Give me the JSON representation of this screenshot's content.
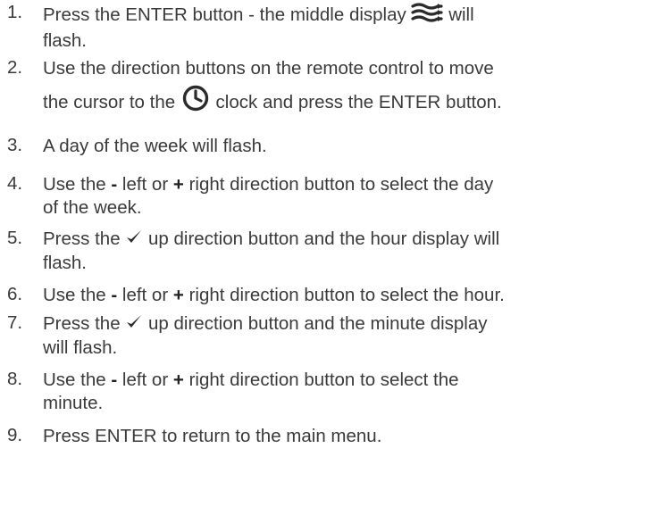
{
  "steps": [
    {
      "number": "1.",
      "line1": "Press the ENTER button - the middle display",
      "line1_after": "will",
      "line2": "flash."
    },
    {
      "number": "2.",
      "line1": "Use the direction buttons on the remote control to move",
      "line2_before": "the cursor to the",
      "line2_after": "clock and press the ENTER button."
    },
    {
      "number": "3.",
      "line1": "A day of the week will flash."
    },
    {
      "number": "4.",
      "line1_before": "Use the",
      "minus": "-",
      "line1_mid": "left or",
      "plus": "+",
      "line1_after": "right direction button to select the day",
      "line2": "of the week."
    },
    {
      "number": "5.",
      "line1_before": "Press the",
      "line1_after": "up direction button and the hour display will",
      "line2": "flash."
    },
    {
      "number": "6.",
      "line1_before": "Use the",
      "minus": "-",
      "line1_mid": "left or",
      "plus": "+",
      "line1_after": "right direction button to select the hour."
    },
    {
      "number": "7.",
      "line1_before": "Press the",
      "line1_after": "up direction button and the minute display",
      "line2": "will flash."
    },
    {
      "number": "8.",
      "line1_before": "Use the",
      "minus": "-",
      "line1_mid": "left or",
      "plus": "+",
      "line1_after": "right direction button to select the",
      "line2": "minute."
    },
    {
      "number": "9.",
      "line1": "Press ENTER to return to the main menu."
    }
  ],
  "icons": {
    "display": "airflow-waves-icon",
    "clock": "clock-icon",
    "check": "checkmark-icon"
  }
}
